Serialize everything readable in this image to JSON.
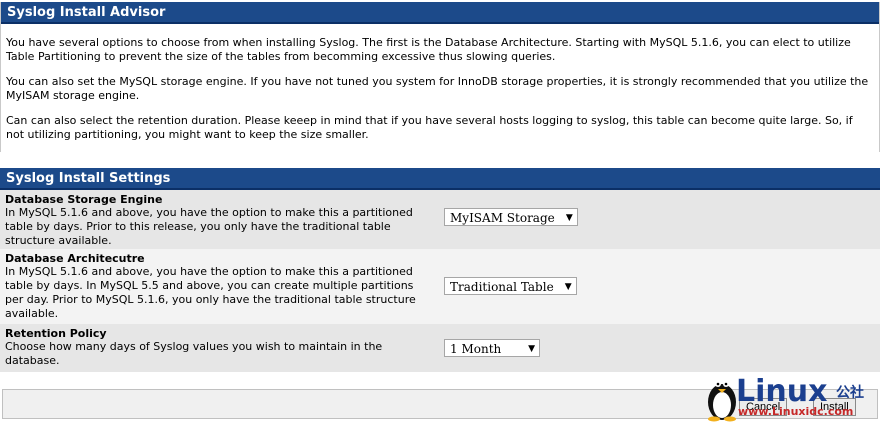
{
  "advisor": {
    "title": "Syslog Install Advisor",
    "paragraphs": [
      "You have several options to choose from when installing Syslog. The first is the Database Architecture. Starting with MySQL 5.1.6, you can elect to utilize Table Partitioning to prevent the size of the tables from becomming excessive thus slowing queries.",
      "You can also set the MySQL storage engine. If you have not tuned you system for InnoDB storage properties, it is strongly recommended that you utilize the MyISAM storage engine.",
      "Can can also select the retention duration. Please keeep in mind that if you have several hosts logging to syslog, this table can become quite large. So, if not utilizing partitioning, you might want to keep the size smaller."
    ]
  },
  "settings": {
    "title": "Syslog Install Settings",
    "rows": [
      {
        "title": "Database Storage Engine",
        "desc": "In MySQL 5.1.6 and above, you have the option to make this a partitioned table by days. Prior to this release, you only have the traditional table structure available.",
        "value": "MyISAM Storage"
      },
      {
        "title": "Database Architecutre",
        "desc": "In MySQL 5.1.6 and above, you have the option to make this a partitioned table by days. In MySQL 5.5 and above, you can create multiple partitions per day. Prior to MySQL 5.1.6, you only have the traditional table structure available.",
        "value": "Traditional Table"
      },
      {
        "title": "Retention Policy",
        "desc": "Choose how many days of Syslog values you wish to maintain in the database.",
        "value": "1 Month"
      }
    ]
  },
  "footer": {
    "cancel_label": "Cancel",
    "install_label": "Install"
  },
  "watermark": {
    "brand": "Linux",
    "cn": "公社",
    "url": "www.Linuxidc.com"
  }
}
